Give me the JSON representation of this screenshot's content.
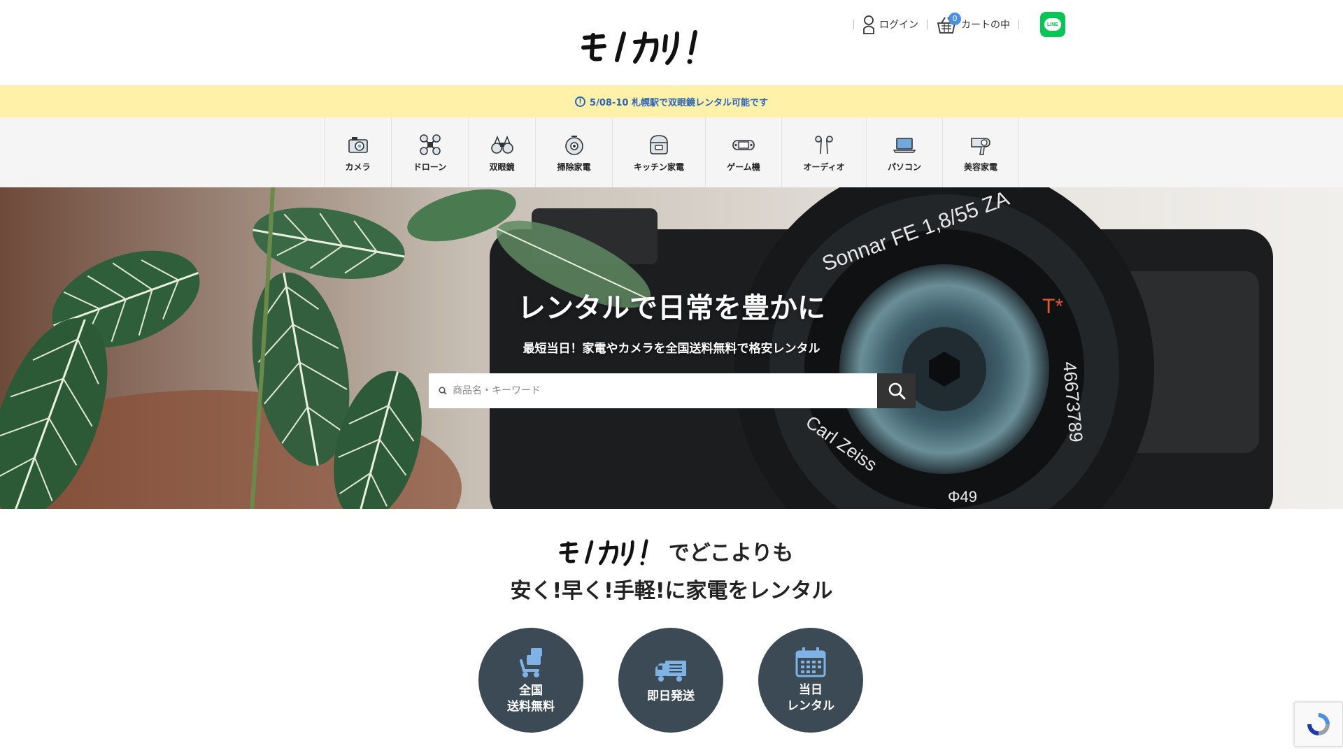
{
  "header": {
    "login_label": "ログイン",
    "cart_label": "カートの中",
    "cart_count": "0",
    "line_label": "LINE"
  },
  "notice": {
    "text": "5/08-10 札幌駅で双眼鏡レンタル可能です",
    "icon": "info-icon"
  },
  "categories": [
    {
      "label": "カメラ",
      "icon": "camera-icon"
    },
    {
      "label": "ドローン",
      "icon": "drone-icon"
    },
    {
      "label": "双眼鏡",
      "icon": "binoculars-icon"
    },
    {
      "label": "掃除家電",
      "icon": "robot-vacuum-icon"
    },
    {
      "label": "キッチン家電",
      "icon": "rice-cooker-icon"
    },
    {
      "label": "ゲーム機",
      "icon": "game-console-icon"
    },
    {
      "label": "オーディオ",
      "icon": "earbuds-icon"
    },
    {
      "label": "パソコン",
      "icon": "laptop-icon"
    },
    {
      "label": "美容家電",
      "icon": "hair-dryer-icon"
    }
  ],
  "hero": {
    "title": "レンタルで日常を豊かに",
    "subtitle": "最短当日！家電やカメラを全国送料無料で格安レンタル",
    "search_placeholder": "商品名・キーワード",
    "lens_text_top": "Sonnar FE 1,8/55 ZA",
    "lens_text_mark": "T*",
    "lens_text_serial": "46673789",
    "lens_text_bottom": "Carl Zeiss",
    "lens_text_size": "Φ49"
  },
  "features": {
    "tagline_suffix": "でどこよりも",
    "tagline_line2": "安く!早く!手軽!に家電をレンタル",
    "items": [
      {
        "line1": "全国",
        "line2": "送料無料",
        "icon": "delivery-cart-icon"
      },
      {
        "line1": "即日発送",
        "line2": "",
        "icon": "truck-icon"
      },
      {
        "line1": "当日",
        "line2": "レンタル",
        "icon": "calendar-icon"
      }
    ]
  },
  "colors": {
    "notice_bg": "#fff2a8",
    "notice_text": "#2b63b8",
    "circle_bg": "#3b4a55",
    "accent_blue": "#4a90e2",
    "line_green": "#06c755"
  }
}
